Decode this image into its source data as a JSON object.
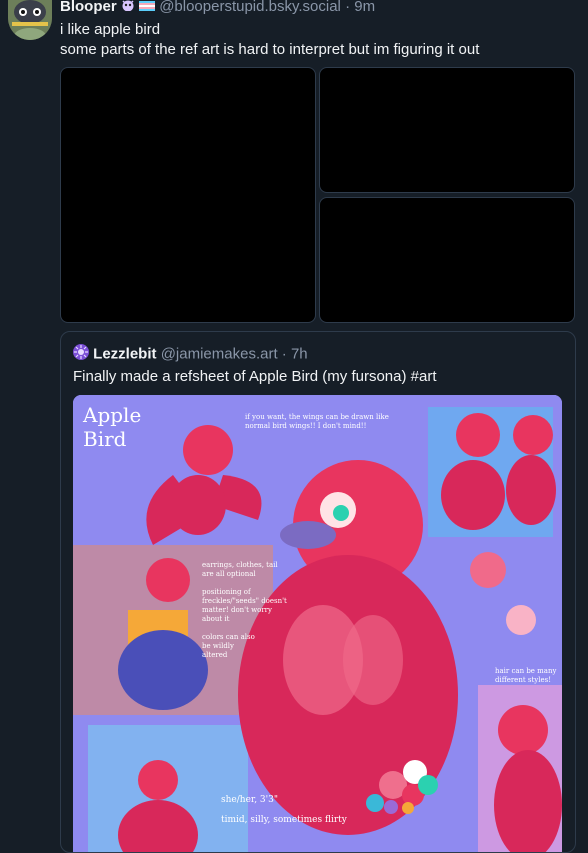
{
  "post": {
    "author_name": "Blooper",
    "handle": "@blooperstupid.bsky.social",
    "time_sep": "·",
    "time": "9m",
    "text_line1": "i like apple bird",
    "text_line2": "some parts of the ref art is hard to interpret but im figuring it out",
    "images": [
      {
        "name": "post-image-1"
      },
      {
        "name": "post-image-2"
      },
      {
        "name": "post-image-3"
      }
    ]
  },
  "quote": {
    "author_name": "Lezzlebit",
    "handle": "@jamiemakes.art",
    "time_sep": "·",
    "time": "7h",
    "text": "Finally made a refsheet of Apple Bird (my fursona) #art",
    "refsheet": {
      "title_line1": "Apple",
      "title_line2": "Bird",
      "wings_note_1": "if you want, the wings can be drawn like",
      "wings_note_2": "normal bird wings!! I don't mind!!",
      "notes": [
        "earrings, clothes, tail",
        "are all optional",
        "",
        "positioning of",
        "freckles/\"seeds\" doesn't",
        "matter! don't worry",
        "about it",
        "",
        "colors can also",
        "be wildly",
        "altered"
      ],
      "hair_note_1": "hair can be many",
      "hair_note_2": "different styles!",
      "pronouns": "she/her, 3'3\"",
      "traits": "timid, silly, sometimes flirty"
    }
  },
  "colors": {
    "background": "#161e27",
    "text": "#f1f3f5",
    "muted": "#8a96a8",
    "border": "#2e3b4b",
    "accent_pink": "#e8355f",
    "accent_purple": "#8c86e8"
  }
}
